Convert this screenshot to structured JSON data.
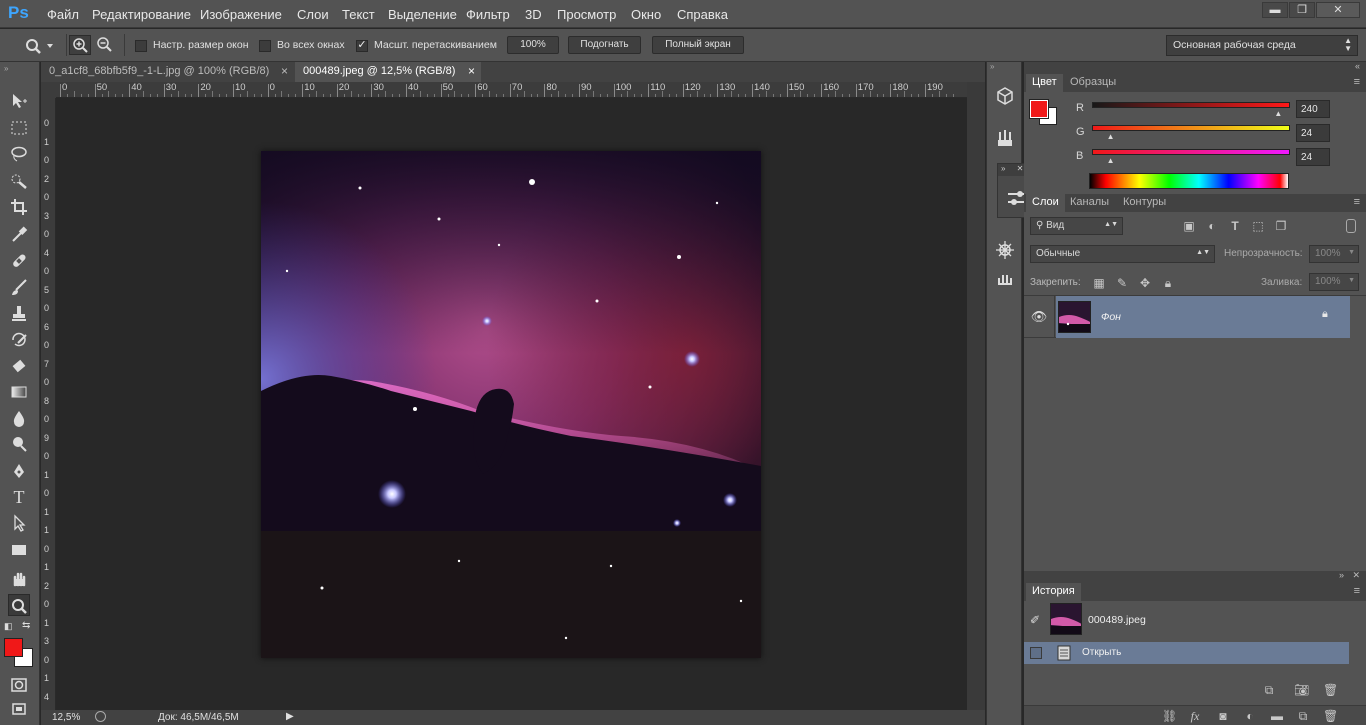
{
  "app": {
    "logo": "Ps"
  },
  "menu": [
    "Файл",
    "Редактирование",
    "Изображение",
    "Слои",
    "Текст",
    "Выделение",
    "Фильтр",
    "3D",
    "Просмотр",
    "Окно",
    "Справка"
  ],
  "window_buttons": {
    "minimize": "▬",
    "restore": "❐",
    "close": "✕"
  },
  "options": {
    "resize_windows": "Настр. размер окон",
    "all_windows": "Во всех окнах",
    "scrubby_zoom": "Масшт. перетаскиванием",
    "btn_100": "100%",
    "btn_fit": "Подогнать",
    "btn_fullscreen": "Полный экран",
    "workspace": "Основная рабочая среда"
  },
  "tabs": [
    {
      "label": "0_a1cf8_68bfb5f9_-1-L.jpg @ 100% (RGB/8)",
      "close": "×"
    },
    {
      "label": "000489.jpeg @ 12,5% (RGB/8)",
      "close": "×"
    }
  ],
  "ruler": {
    "h": [
      "0",
      "50",
      "40",
      "30",
      "20",
      "10",
      "0",
      "10",
      "20",
      "30",
      "40",
      "50",
      "60",
      "70",
      "80",
      "90",
      "100",
      "110",
      "120",
      "130",
      "140",
      "150",
      "160",
      "170",
      "180",
      "190"
    ],
    "v": [
      "0",
      "1",
      "0",
      "2",
      "0",
      "3",
      "0",
      "4",
      "0",
      "5",
      "0",
      "6",
      "0",
      "7",
      "0",
      "8",
      "0",
      "9",
      "0",
      "1",
      "0",
      "1",
      "1",
      "0",
      "1",
      "2",
      "0",
      "1",
      "3",
      "0",
      "1",
      "4"
    ]
  },
  "status": {
    "zoom": "12,5%",
    "doc": "Док: 46,5M/46,5M"
  },
  "color_panel": {
    "tabs": [
      "Цвет",
      "Образцы"
    ],
    "r_label": "R",
    "g_label": "G",
    "b_label": "B",
    "r": "240",
    "g": "24",
    "b": "24",
    "foreground": "#f01818",
    "background": "#ffffff"
  },
  "layers_panel": {
    "tabs": [
      "Слои",
      "Каналы",
      "Контуры"
    ],
    "filter": "Вид",
    "blend_mode": "Обычные",
    "opacity_label": "Непрозрачность:",
    "opacity_value": "100%",
    "lock_label": "Закрепить:",
    "fill_label": "Заливка:",
    "fill_value": "100%",
    "layers": [
      {
        "name": "Фон",
        "locked": true,
        "visible": true
      }
    ]
  },
  "history_panel": {
    "tab": "История",
    "snapshot": "000489.jpeg",
    "items": [
      "Открыть"
    ]
  },
  "colors": {
    "accent": "#3ea6ff",
    "selected_row": "#6a7b96",
    "foreground_swatch": "#f01818"
  }
}
